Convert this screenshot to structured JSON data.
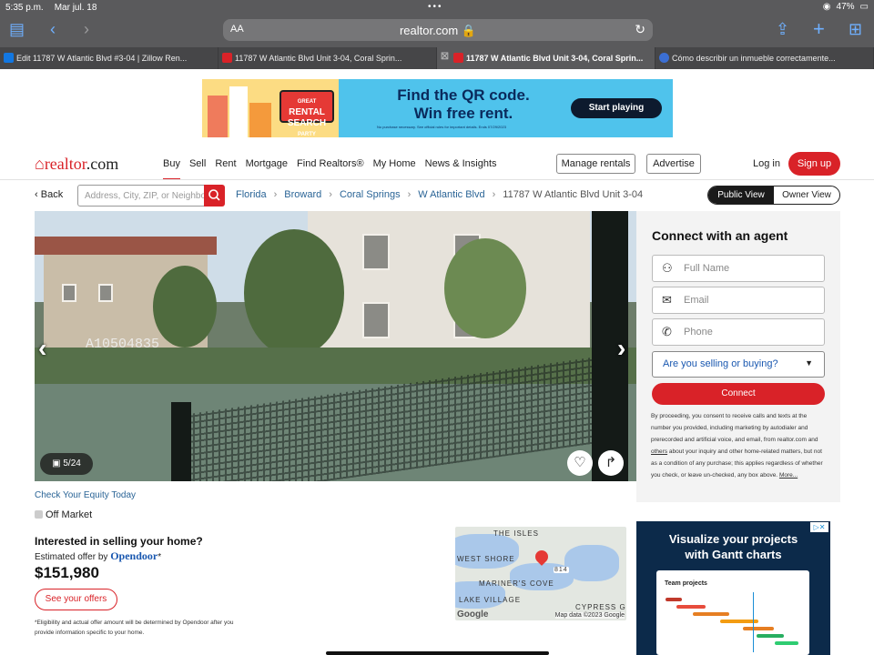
{
  "status_bar": {
    "time": "5:35 p.m.",
    "date": "Mar jul. 18",
    "dots": "•••",
    "battery": "47%"
  },
  "browser": {
    "text_size": "AA",
    "url": "realtor.com 🔒",
    "tabs": [
      {
        "label": "Edit 11787 W Atlantic Blvd #3-04 | Zillow Ren..."
      },
      {
        "label": "11787 W Atlantic Blvd Unit 3-04, Coral Sprin..."
      },
      {
        "label": "11787 W Atlantic Blvd Unit 3-04, Coral Sprin..."
      },
      {
        "label": "Cómo describir un inmueble correctamente..."
      }
    ]
  },
  "ad_banner": {
    "badge_line1": "GREAT",
    "badge_line2": "RENTAL",
    "badge_line3": "SEARCH",
    "badge_line4": "PARTY",
    "headline_1": "Find the QR code.",
    "headline_2": "Win free rent.",
    "fine_print": "No purchase necessary. See official rules for important details. Ends 07/29/2023",
    "cta": "Start playing"
  },
  "header": {
    "logo_main": "realtor",
    "logo_suffix": ".com",
    "nav": [
      "Buy",
      "Sell",
      "Rent",
      "Mortgage",
      "Find Realtors®",
      "My Home",
      "News & Insights"
    ],
    "manage_rentals": "Manage rentals",
    "advertise": "Advertise",
    "login": "Log in",
    "signup": "Sign up"
  },
  "search_row": {
    "back": "Back",
    "search_placeholder": "Address, City, ZIP, or Neighborhood",
    "breadcrumbs": [
      "Florida",
      "Broward",
      "Coral Springs",
      "W Atlantic Blvd"
    ],
    "breadcrumb_current": "11787 W Atlantic Blvd Unit 3-04",
    "public_view": "Public View",
    "owner_view": "Owner View"
  },
  "photo": {
    "watermark": "A10504835",
    "count": "5/24"
  },
  "connect": {
    "title": "Connect with an agent",
    "full_name_placeholder": "Full Name",
    "email_placeholder": "Email",
    "phone_placeholder": "Phone",
    "select_value": "Are you selling or buying?",
    "button": "Connect",
    "disclaimer_part1": "By proceeding, you consent to receive calls and texts at the number you provided, including marketing by autodialer and prerecorded and artificial voice, and email, from realtor.com and",
    "disclaimer_link1": "others",
    "disclaimer_part2": "about your inquiry and other home-related matters, but not as a condition of any purchase; this applies regardless of whether you check, or leave un-checked, any box above.",
    "disclaimer_more": "More..."
  },
  "listing": {
    "equity_link": "Check Your Equity Today",
    "status": "Off Market",
    "selling_title": "Interested in selling your home?",
    "estimated_prefix": "Estimated offer by",
    "estimated_brand": "Opendoor",
    "price": "$151,980",
    "offers_button": "See your offers",
    "fine_print": "*Eligibility and actual offer amount will be determined by Opendoor after you provide information specific to your home."
  },
  "map": {
    "labels": [
      "THE ISLES",
      "WEST SHORE",
      "MARINER'S COVE",
      "LAKE VILLAGE",
      "CYPRESS G"
    ],
    "road": "814",
    "google": "Google",
    "map_data": "Map data ©2023 Google"
  },
  "side_ad": {
    "headline_1": "Visualize your projects",
    "headline_2": "with Gantt charts",
    "panel_title": "Team projects",
    "adchoices": "▷✕"
  },
  "colors": {
    "brand_red": "#d92228",
    "link_blue": "#2a6496"
  }
}
